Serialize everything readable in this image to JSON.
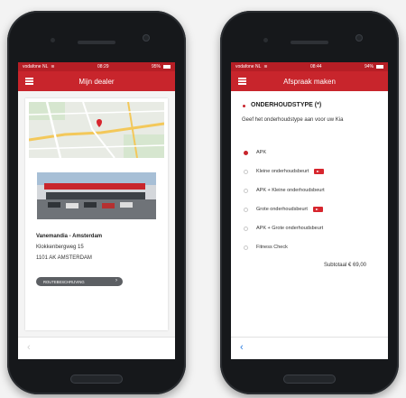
{
  "left_phone": {
    "status": {
      "carrier": "vodafone NL",
      "time": "08:29",
      "battery": "95%"
    },
    "appbar": {
      "title": "Mijn dealer"
    },
    "dealer": {
      "name": "Vanemandia - Amsterdam",
      "street": "Klokkenbergweg 15",
      "city": "1101 AK AMSTERDAM",
      "route_button": "ROUTEBESCHRIJVING"
    },
    "back_icon": "‹"
  },
  "right_phone": {
    "status": {
      "carrier": "vodafone NL",
      "time": "08:44",
      "battery": "94%"
    },
    "appbar": {
      "title": "Afspraak maken"
    },
    "section_title": "ONDERHOUDSTYPE (*)",
    "section_desc": "Geef het onderhoudstype aan voor uw Kia",
    "options": [
      {
        "label": "APK",
        "selected": true,
        "video": false
      },
      {
        "label": "Kleine onderhoudsbeurt",
        "selected": false,
        "video": true
      },
      {
        "label": "APK + Kleine onderhoudsbeurt",
        "selected": false,
        "video": false
      },
      {
        "label": "Grote onderhoudsbeurt",
        "selected": false,
        "video": true
      },
      {
        "label": "APK + Grote onderhoudsbeurt",
        "selected": false,
        "video": false
      },
      {
        "label": "Fitness Check",
        "selected": false,
        "video": false
      }
    ],
    "subtotal": "Subtotaal € 69,00",
    "back_icon": "‹"
  },
  "colors": {
    "brand_red": "#c8252c",
    "status_red": "#b61e25",
    "back_arrow_blue": "#2a7de1"
  }
}
